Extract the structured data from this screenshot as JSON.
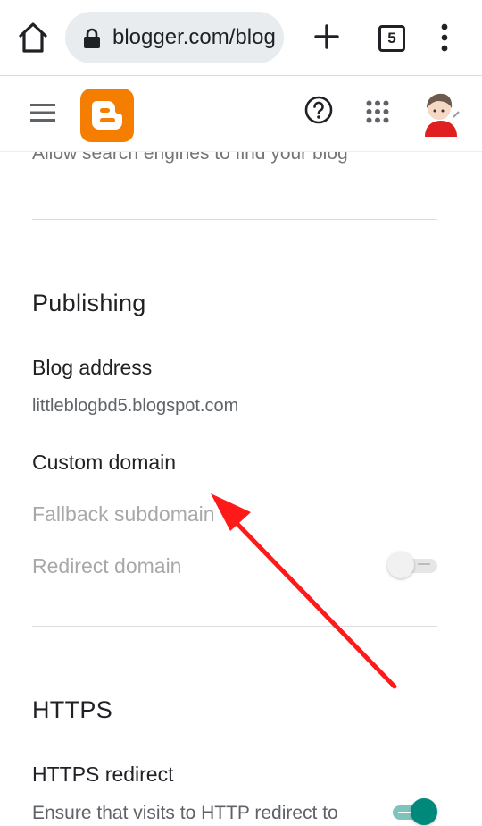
{
  "browser": {
    "url": "blogger.com/blog",
    "tab_count": "5"
  },
  "settings": {
    "prev_item_sub": "Allow search engines to find your blog",
    "publishing": {
      "title": "Publishing",
      "blog_address_label": "Blog address",
      "blog_address_value": "littleblogbd5.blogspot.com",
      "custom_domain_label": "Custom domain",
      "fallback_subdomain_label": "Fallback subdomain",
      "redirect_domain_label": "Redirect domain",
      "redirect_domain_enabled": false
    },
    "https": {
      "title": "HTTPS",
      "redirect_label": "HTTPS redirect",
      "redirect_desc": "Ensure that visits to HTTP redirect to",
      "redirect_enabled": true
    }
  },
  "colors": {
    "blogger_orange": "#f57d00",
    "toggle_on": "#00897b",
    "annotation_arrow": "#ff1a1a"
  }
}
